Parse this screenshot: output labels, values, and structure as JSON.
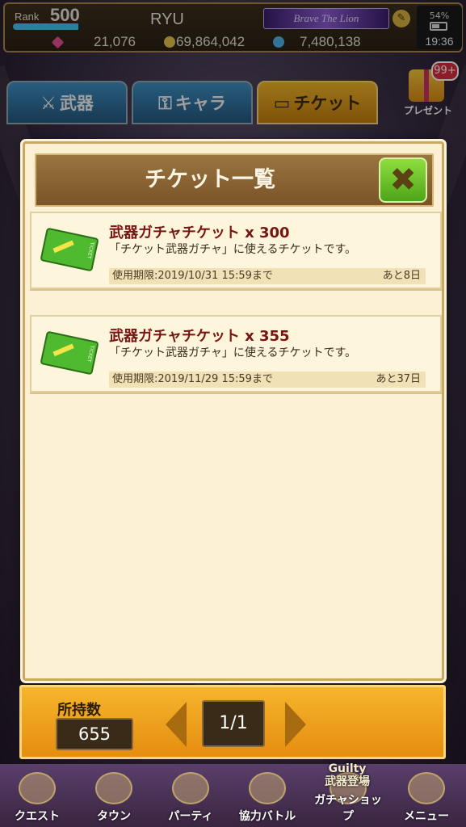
{
  "status": {
    "rank_label": "Rank",
    "rank_value": "500",
    "exp_progress": 0.97,
    "player_name": "RYU",
    "title_badge": "Brave The Lion",
    "gems": "21,076",
    "coins": "69,864,042",
    "drops": "7,480,138",
    "battery": "54%",
    "clock": "19:36"
  },
  "tabs": [
    {
      "label": "武器"
    },
    {
      "label": "キャラ"
    },
    {
      "label": "チケット"
    }
  ],
  "present": {
    "badge": "99+",
    "label": "プレゼント"
  },
  "modal": {
    "title": "チケット一覧",
    "close_symbol": "✖",
    "tickets": [
      {
        "name": "武器ガチャチケット x 300",
        "description": "「チケット武器ガチャ」に使えるチケットです。",
        "expiry": "使用期限:2019/10/31 15:59まで",
        "remaining": "あと8日"
      },
      {
        "name": "武器ガチャチケット x 355",
        "description": "「チケット武器ガチャ」に使えるチケットです。",
        "expiry": "使用期限:2019/11/29 15:59まで",
        "remaining": "あと37日"
      }
    ]
  },
  "footer": {
    "owned_label": "所持数",
    "owned_value": "655",
    "page": "1/1"
  },
  "nav": {
    "items": [
      "クエスト",
      "タウン",
      "パーティ",
      "協力バトル",
      "ガチャショップ",
      "メニュー"
    ],
    "banner_line1": "Guilty",
    "banner_line2": "武器登場"
  }
}
